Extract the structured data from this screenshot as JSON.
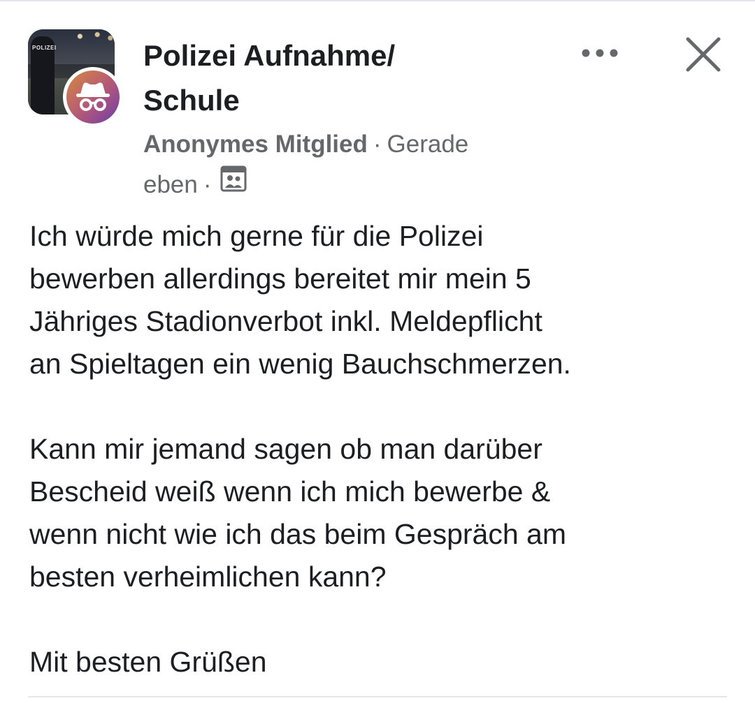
{
  "post": {
    "group": {
      "name_line1": "Polizei Aufnahme/",
      "name_line2": "Schule",
      "avatar_icon": "police-group-photo",
      "anonymous_badge_icon": "incognito-icon"
    },
    "author": "Anonymes Mitglied",
    "separator": "·",
    "time_part1": "Gerade",
    "time_part2": "eben",
    "audience_icon": "group-members-icon",
    "body": {
      "paragraph_1_lines": [
        "Ich würde mich gerne für die Polizei",
        "bewerben allerdings bereitet mir mein 5",
        "Jähriges Stadionverbot inkl. Meldepflicht",
        "an Spieltagen ein wenig Bauchschmerzen."
      ],
      "paragraph_2_lines": [
        "Kann mir jemand sagen ob man darüber",
        "Bescheid weiß wenn ich mich bewerbe &",
        "wenn nicht wie ich das beim Gespräch am",
        "besten verheimlichen kann?"
      ],
      "paragraph_3_lines": [
        "Mit besten Grüßen"
      ]
    }
  },
  "controls": {
    "more_icon": "more-horizontal-icon",
    "close_icon": "close-icon"
  },
  "colors": {
    "text_primary": "#1c1e21",
    "text_secondary": "#65676b",
    "divider": "#e4e6eb",
    "badge_gradient_start": "#d78a3d",
    "badge_gradient_end": "#6b3fa8"
  }
}
